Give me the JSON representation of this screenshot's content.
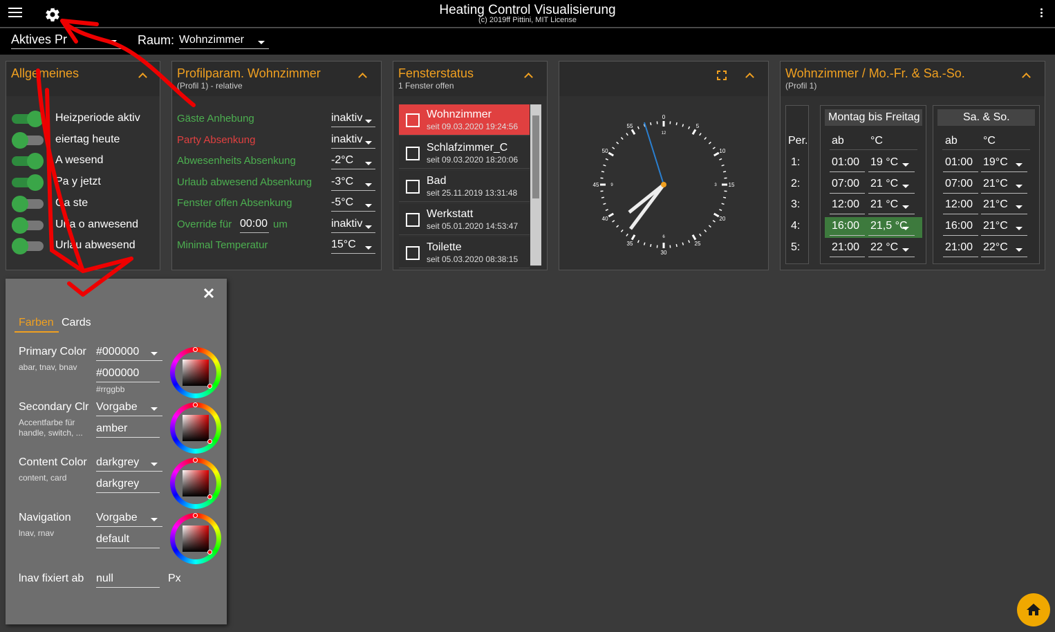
{
  "header": {
    "title": "Heating Control Visualisierung",
    "subtitle": "(c) 2019ff Pittini, MIT License",
    "profile_label": "Aktives Pr",
    "room_label": "Raum:",
    "room_value": "Wohnzimmer"
  },
  "general_card": {
    "title": "Allgemeines",
    "toggles": [
      {
        "label": "Heizperiode aktiv",
        "on": true
      },
      {
        "label": "eiertag heute",
        "on": false
      },
      {
        "label": "A  wesend",
        "on": true
      },
      {
        "label": "Pa  y jetzt",
        "on": true
      },
      {
        "label": "Ga  ste",
        "on": false
      },
      {
        "label": "Urla  o anwesend",
        "on": false
      },
      {
        "label": "Urlau  abwesend",
        "on": false
      }
    ]
  },
  "profile_card": {
    "title": "Profilparam. Wohnzimmer",
    "subtitle": "(Profil 1) - relative",
    "rows": [
      {
        "label": "Gäste Anhebung",
        "value": "inaktiv"
      },
      {
        "label": "Party Absenkung",
        "value": "inaktiv"
      },
      {
        "label": "Abwesenheits Absenkung",
        "value": "-2°C"
      },
      {
        "label": "Urlaub abwesend Absenkung",
        "value": "-3°C"
      },
      {
        "label": "Fenster offen Absenkung",
        "value": "-5°C"
      },
      {
        "label": "Override für",
        "value": "inaktiv",
        "time": "00:00",
        "suffix": "um"
      },
      {
        "label": "Minimal Temperatur",
        "value": "15°C"
      }
    ]
  },
  "window_card": {
    "title": "Fensterstatus",
    "subtitle": "1 Fenster offen",
    "items": [
      {
        "name": "Wohnzimmer",
        "since": "seit 09.03.2020 19:24:56",
        "open": true
      },
      {
        "name": "Schlafzimmer_C",
        "since": "seit 09.03.2020 18:20:06",
        "open": false
      },
      {
        "name": "Bad",
        "since": "seit 25.11.2019 13:31:48",
        "open": false
      },
      {
        "name": "Werkstatt",
        "since": "seit 05.01.2020 14:53:47",
        "open": false
      },
      {
        "name": "Toilette",
        "since": "seit 05.03.2020 08:38:15",
        "open": false
      }
    ]
  },
  "clock_card": {
    "numbers": [
      "0",
      "5",
      "10",
      "15",
      "20",
      "25",
      "30",
      "35",
      "40",
      "45",
      "50",
      "55"
    ],
    "small_numbers": [
      "12",
      "3",
      "6",
      "9"
    ]
  },
  "schedule_card": {
    "title": "Wohnzimmer / Mo.-Fr. & Sa.-So.",
    "subtitle": "(Profil 1)",
    "period_header": "Per.",
    "periods": [
      "1:",
      "2:",
      "3:",
      "4:",
      "5:"
    ],
    "weekday": {
      "title": "Montag bis Freitag",
      "col_time": "ab",
      "col_temp": "°C",
      "rows": [
        {
          "time": "01:00",
          "temp": "19 °C"
        },
        {
          "time": "07:00",
          "temp": "21 °C"
        },
        {
          "time": "12:00",
          "temp": "21 °C"
        },
        {
          "time": "16:00",
          "temp": "21,5 °C",
          "active": true
        },
        {
          "time": "21:00",
          "temp": "22 °C"
        }
      ]
    },
    "weekend": {
      "title": "Sa. & So.",
      "col_time": "ab",
      "col_temp": "°C",
      "rows": [
        {
          "time": "01:00",
          "temp": "19°C"
        },
        {
          "time": "07:00",
          "temp": "21°C"
        },
        {
          "time": "12:00",
          "temp": "21°C"
        },
        {
          "time": "16:00",
          "temp": "21°C"
        },
        {
          "time": "21:00",
          "temp": "22°C"
        }
      ]
    }
  },
  "settings": {
    "tab_colors": "Farben",
    "tab_cards": "Cards",
    "primary": {
      "label": "Primary Color",
      "desc": "abar, tnav, bnav",
      "select": "#000000",
      "input": "#000000",
      "hint": "#rrggbb"
    },
    "secondary": {
      "label": "Secondary Clr",
      "desc1": "Accentfarbe für",
      "desc2": "handle, switch, ...",
      "select": "Vorgabe",
      "input": "amber"
    },
    "content": {
      "label": "Content Color",
      "desc": "content, card",
      "select": "darkgrey",
      "input": "darkgrey"
    },
    "navigation": {
      "label": "Navigation",
      "desc": "lnav, rnav",
      "select": "Vorgabe",
      "input": "default"
    },
    "lnav": {
      "label": "lnav fixiert ab",
      "input": "null",
      "unit": "Px"
    }
  },
  "colors": {
    "accent": "#f0a020",
    "green": "#4caf50",
    "red": "#e04040",
    "active_row": "#3d7a3d"
  }
}
